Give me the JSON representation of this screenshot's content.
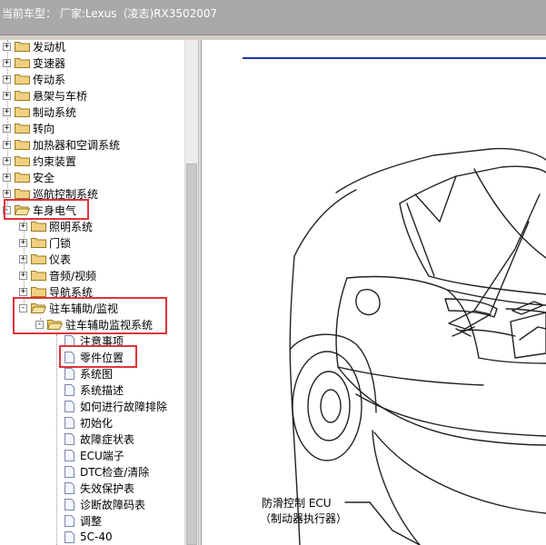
{
  "window": {
    "title": "当前车型： 厂家:Lexus（凌志)RX3502007"
  },
  "tree": {
    "top_items": [
      {
        "label": "发动机",
        "expander": "+"
      },
      {
        "label": "变速器",
        "expander": "+"
      },
      {
        "label": "传动系",
        "expander": "+"
      },
      {
        "label": "悬架与车桥",
        "expander": "+"
      },
      {
        "label": "制动系统",
        "expander": "+"
      },
      {
        "label": "转向",
        "expander": "+"
      },
      {
        "label": "加热器和空调系统",
        "expander": "+"
      },
      {
        "label": "约束装置",
        "expander": "+"
      },
      {
        "label": "安全",
        "expander": "+"
      },
      {
        "label": "巡航控制系统",
        "expander": "+"
      },
      {
        "label": "车身电气",
        "expander": "-"
      }
    ],
    "body_children": [
      {
        "label": "照明系统",
        "expander": "+"
      },
      {
        "label": "门锁",
        "expander": "+"
      },
      {
        "label": "仪表",
        "expander": "+"
      },
      {
        "label": "音频/视频",
        "expander": "+"
      },
      {
        "label": "导航系统",
        "expander": "+"
      },
      {
        "label": "驻车辅助/监视",
        "expander": "-"
      }
    ],
    "assist_child": {
      "label": "驻车辅助监视系统",
      "expander": "-"
    },
    "docs": [
      "注意事项",
      "零件位置",
      "系统图",
      "系统描述",
      "如何进行故障排除",
      "初始化",
      "故障症状表",
      "ECU端子",
      "DTC检查/清除",
      "失效保护表",
      "诊断故障码表",
      "调整",
      "5C-40"
    ],
    "selected": "零件位置"
  },
  "diagram": {
    "callout_line1": "防滑控制 ECU",
    "callout_line2": "（制动器执行器）"
  },
  "colors": {
    "highlight": "#e0333a",
    "header_rule": "#2233aa",
    "folder": "#f0d080"
  }
}
